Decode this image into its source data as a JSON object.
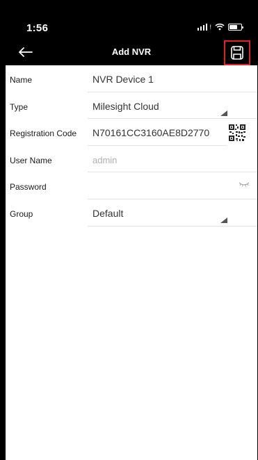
{
  "status_bar": {
    "time": "1:56"
  },
  "header": {
    "title": "Add NVR",
    "back_icon": "arrow-left-icon",
    "save_icon": "floppy-disk-icon",
    "save_highlight_color": "#e0202a"
  },
  "form": {
    "name": {
      "label": "Name",
      "value": "NVR Device 1"
    },
    "type": {
      "label": "Type",
      "value": "Milesight Cloud"
    },
    "registration_code": {
      "label": "Registration Code",
      "value": "N70161CC3160AE8D2770"
    },
    "user_name": {
      "label": "User Name",
      "placeholder": "admin"
    },
    "password": {
      "label": "Password",
      "value": ""
    },
    "group": {
      "label": "Group",
      "value": "Default"
    }
  }
}
